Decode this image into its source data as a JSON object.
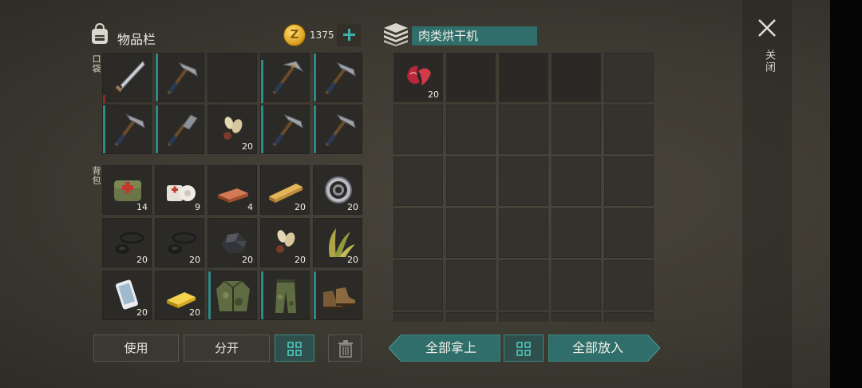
{
  "inventory": {
    "title": "物品栏",
    "coins": "1375",
    "pocket_label": "口袋",
    "backpack_label": "背包",
    "pocket_slots": [
      {
        "item": "machete-icon",
        "count": ""
      },
      {
        "item": "pickaxe-icon",
        "count": ""
      },
      {
        "item": "empty",
        "count": ""
      },
      {
        "item": "pickaxe-icon",
        "count": ""
      },
      {
        "item": "pickaxe-icon",
        "count": ""
      },
      {
        "item": "pickaxe-icon",
        "count": ""
      },
      {
        "item": "shovel-icon",
        "count": ""
      },
      {
        "item": "seeds-icon",
        "count": "20"
      },
      {
        "item": "pickaxe-icon",
        "count": ""
      },
      {
        "item": "pickaxe-icon",
        "count": ""
      }
    ],
    "backpack_slots": [
      {
        "item": "medkit-bag-icon",
        "count": "14"
      },
      {
        "item": "bandage-icon",
        "count": "9"
      },
      {
        "item": "copper-ingot-icon",
        "count": "4"
      },
      {
        "item": "wood-plank-icon",
        "count": "20"
      },
      {
        "item": "bearing-icon",
        "count": "20"
      },
      {
        "item": "rubber-parts-icon",
        "count": "20"
      },
      {
        "item": "rubber-parts-icon",
        "count": "20"
      },
      {
        "item": "coal-ore-icon",
        "count": "20"
      },
      {
        "item": "seeds-icon",
        "count": "20"
      },
      {
        "item": "plant-fiber-icon",
        "count": "20"
      },
      {
        "item": "smartphone-icon",
        "count": "20"
      },
      {
        "item": "gold-bar-icon",
        "count": "20"
      },
      {
        "item": "camo-jacket-icon",
        "count": ""
      },
      {
        "item": "camo-pants-icon",
        "count": ""
      },
      {
        "item": "boots-icon",
        "count": ""
      }
    ],
    "buttons": {
      "use": "使用",
      "split": "分开"
    }
  },
  "container": {
    "title": "肉类烘干机",
    "slots": [
      {
        "item": "raw-meat-icon",
        "count": "20"
      }
    ],
    "buttons": {
      "take_all": "全部拿上",
      "put_all": "全部放入"
    }
  },
  "close_label": "关闭",
  "colors": {
    "accent_teal": "#2f6e6a",
    "durability_teal": "#2f8b88",
    "coin_gold": "#e0a526"
  }
}
